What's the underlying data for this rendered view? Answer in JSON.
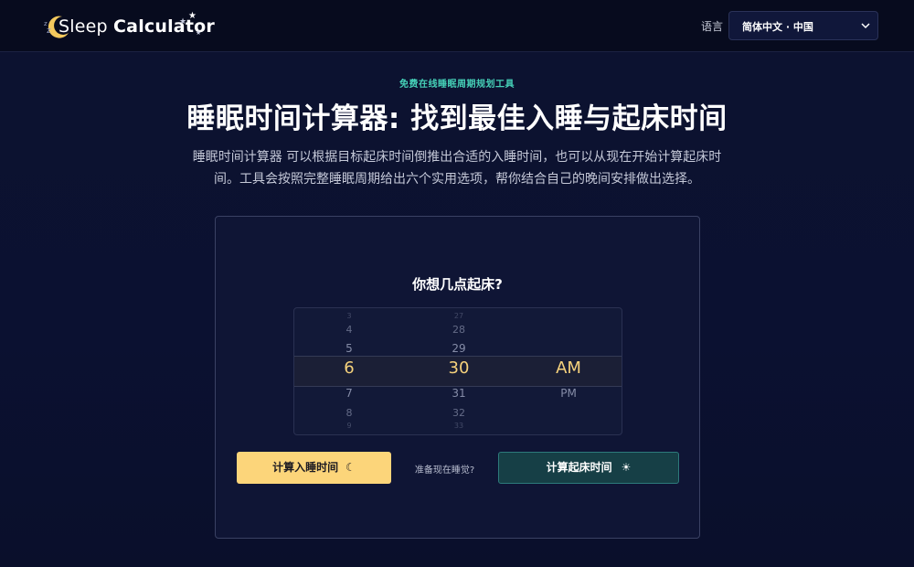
{
  "header": {
    "logo_text_light": "Sleep ",
    "logo_text_bold": "Calculator",
    "lang_label": "语言",
    "lang_selected": "简体中文 · 中国"
  },
  "hero": {
    "eyebrow": "免费在线睡眠周期规划工具",
    "title": "睡眠时间计算器: 找到最佳入睡与起床时间",
    "description": "睡眠时间计算器 可以根据目标起床时间倒推出合适的入睡时间，也可以从现在开始计算起床时间。工具会按照完整睡眠周期给出六个实用选项，帮你结合自己的晚间安排做出选择。"
  },
  "card": {
    "question": "你想几点起床?",
    "picker": {
      "hours": [
        "3",
        "4",
        "5",
        "6",
        "7",
        "8",
        "9"
      ],
      "minutes": [
        "27",
        "28",
        "29",
        "30",
        "31",
        "32",
        "33"
      ],
      "periods": [
        "",
        "",
        "",
        "AM",
        "PM",
        "",
        ""
      ]
    },
    "bedtime_button": "计算入睡时间",
    "bedtime_icon": "☾",
    "or_text": "准备现在睡觉?",
    "wake_button": "计算起床时间",
    "wake_icon": "☀"
  },
  "colors": {
    "accent_yellow": "#fcd57a",
    "accent_teal": "#46d1b8",
    "selected_value": "#f6d27c"
  },
  "icons": [
    "moon-logo-icon",
    "stars-icon",
    "chevron-down-icon",
    "moon-icon",
    "sun-icon"
  ]
}
